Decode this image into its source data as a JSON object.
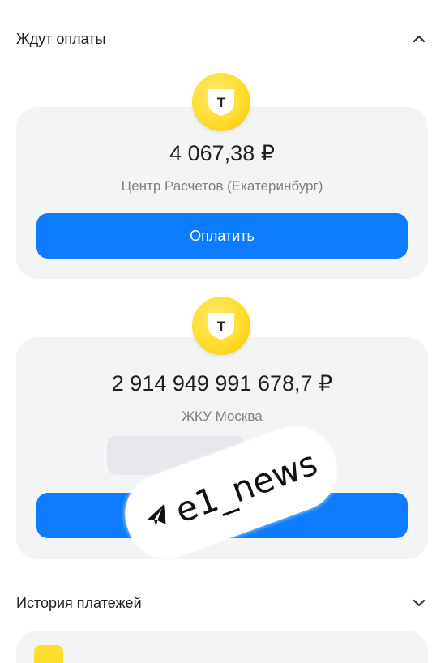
{
  "pending": {
    "title": "Ждут оплаты",
    "chevron_icon": "chevron-up-icon"
  },
  "bills": [
    {
      "logo_icon": "bank-shield-logo-icon",
      "logo_letter": "Т",
      "amount": "4 067,38 ₽",
      "payee": "Центр Расчетов (Екатеринбург)",
      "pay_label": "Оплатить"
    },
    {
      "logo_icon": "bank-shield-logo-icon",
      "logo_letter": "Т",
      "amount": "2 914 949 991 678,7 ₽",
      "payee": "ЖКУ Москва",
      "pay_label": "ть"
    }
  ],
  "watermark": {
    "text": "e1_news",
    "icon": "telegram-icon"
  },
  "history": {
    "title": "История платежей",
    "chevron_icon": "chevron-down-icon"
  },
  "colors": {
    "accent": "#0d7cff",
    "brand_yellow": "#ffdd2d",
    "card_bg": "#f3f4f6"
  }
}
